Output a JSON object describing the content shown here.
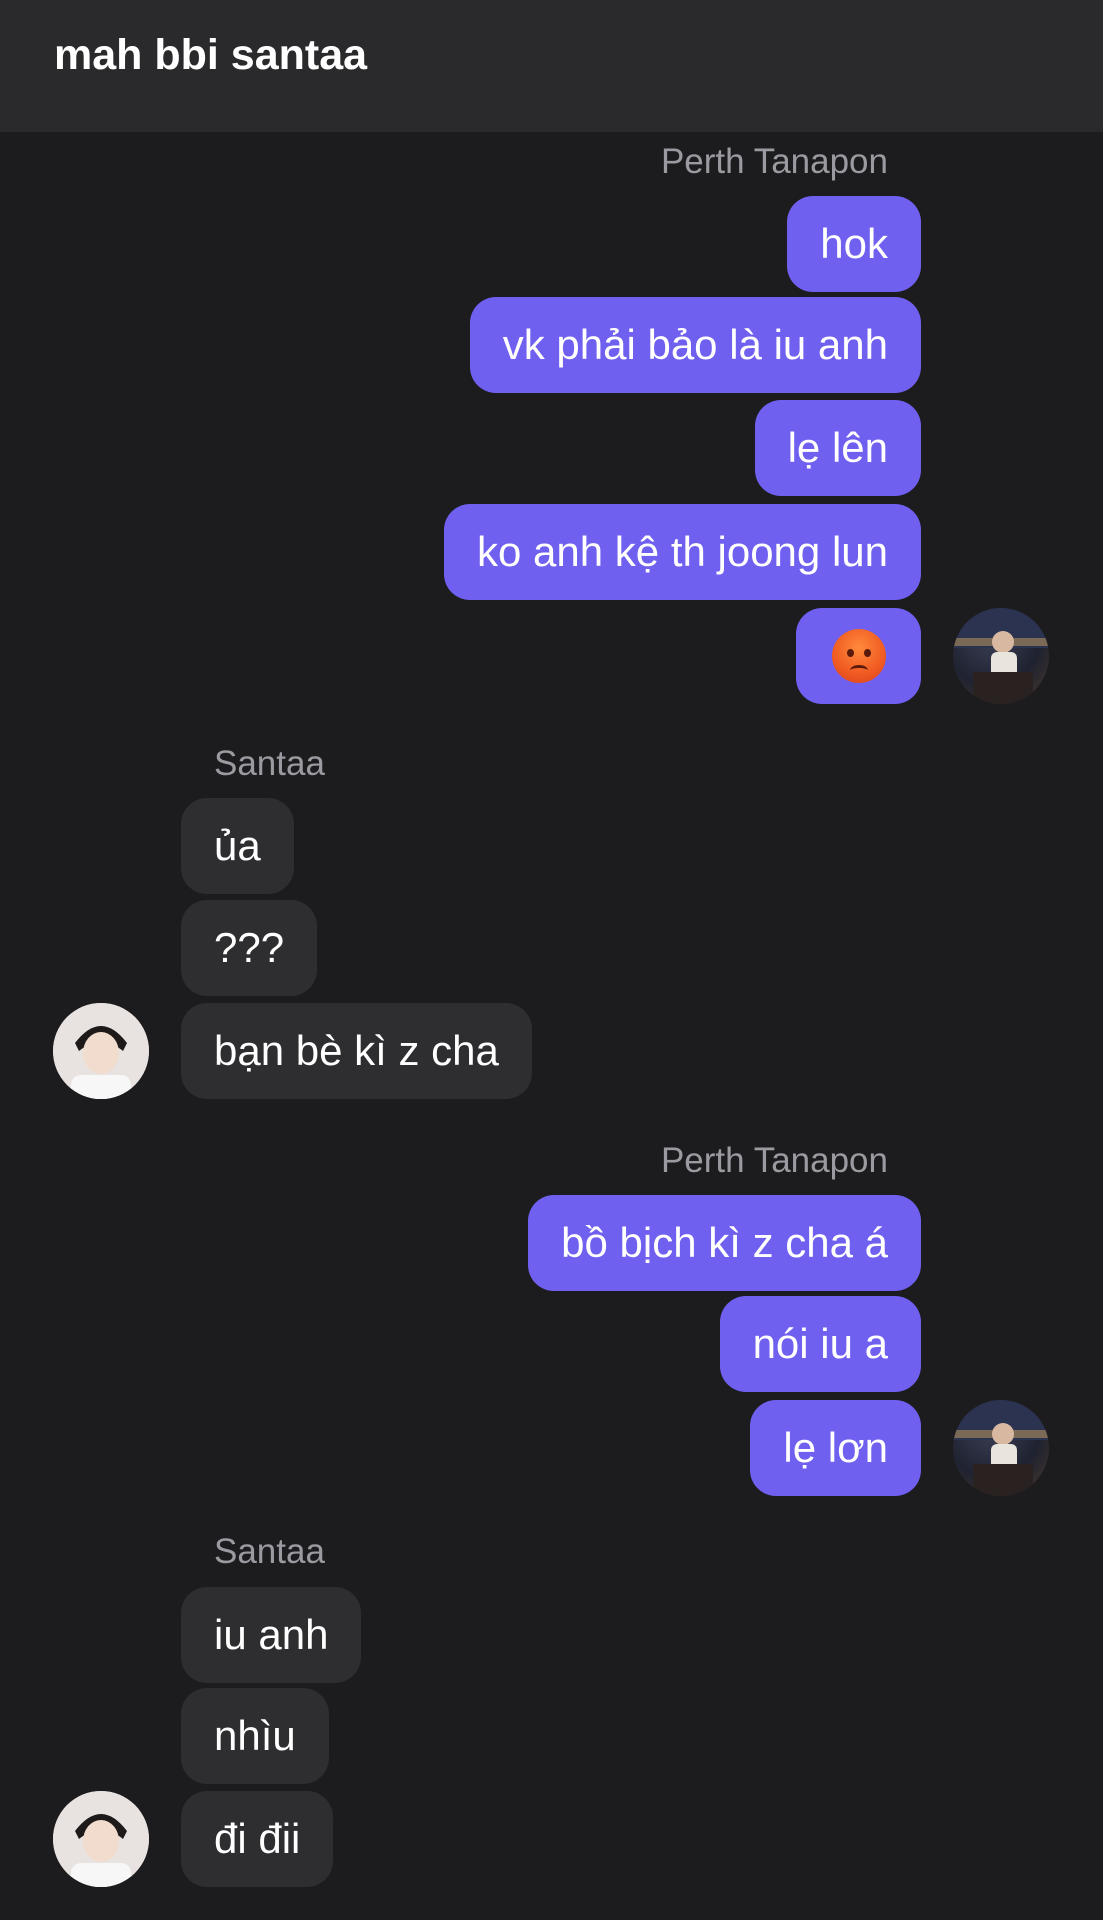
{
  "header": {
    "title": "mah bbi santaa"
  },
  "groups": [
    {
      "sender": "Perth Tanapon",
      "messages": [
        "hok",
        "vk phải bảo là iu anh",
        "lẹ lên",
        "ko anh kệ th joong lun"
      ],
      "emoji_message": "angry-face"
    },
    {
      "sender": "Santaa",
      "messages": [
        "ủa",
        "???",
        "bạn bè kì z cha"
      ]
    },
    {
      "sender": "Perth Tanapon",
      "messages": [
        "bồ bịch kì z cha á",
        "nói iu a",
        "lẹ lơn"
      ]
    },
    {
      "sender": "Santaa",
      "messages": [
        "iu anh",
        "nhìu",
        "đi đii"
      ]
    }
  ],
  "colors": {
    "background": "#1c1c1f",
    "header": "#2a2a2d",
    "outgoing_bubble": "#7060f0",
    "incoming_bubble": "#2e2e31",
    "sender_label": "#9a9aa0"
  }
}
